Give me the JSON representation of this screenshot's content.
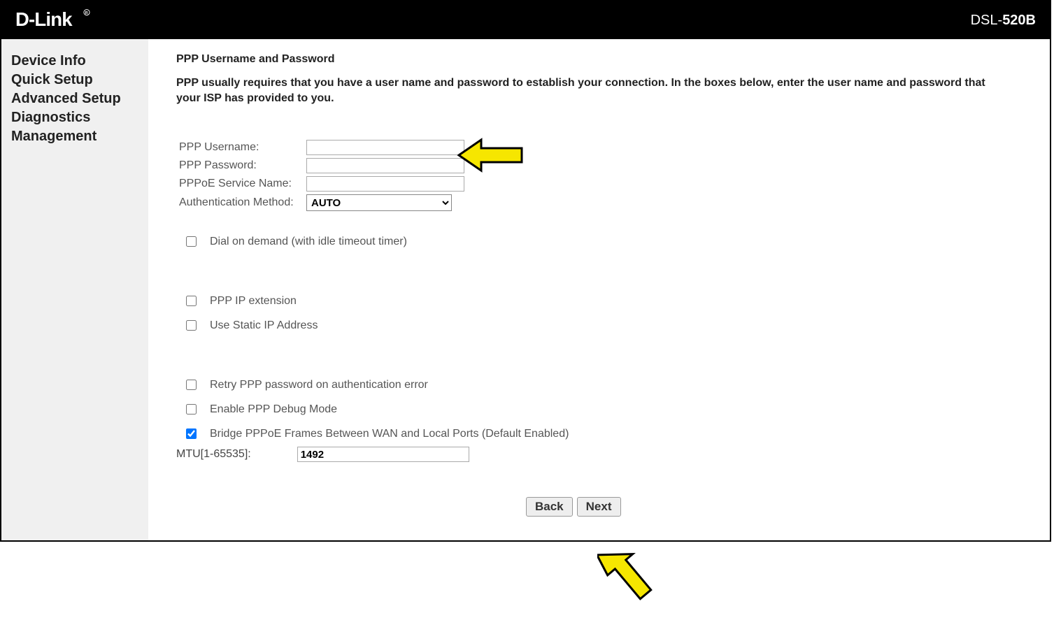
{
  "header": {
    "brand": "D-Link",
    "model_prefix": "DSL-",
    "model_bold": "520B"
  },
  "sidebar": {
    "items": [
      {
        "label": "Device Info"
      },
      {
        "label": "Quick Setup"
      },
      {
        "label": "Advanced Setup"
      },
      {
        "label": "Diagnostics"
      },
      {
        "label": "Management"
      }
    ]
  },
  "main": {
    "heading": "PPP Username and Password",
    "intro": "PPP usually requires that you have a user name and password to establish your connection. In the boxes below, enter the user name and password that your ISP has provided to you.",
    "form": {
      "username_label": "PPP Username:",
      "username_value": "",
      "password_label": "PPP Password:",
      "password_value": "",
      "service_label": "PPPoE Service Name:",
      "service_value": "",
      "auth_label": "Authentication Method:",
      "auth_value": "AUTO"
    },
    "checks": {
      "dial": "Dial on demand (with idle timeout timer)",
      "ipext": "PPP IP extension",
      "staticip": "Use Static IP Address",
      "retry": "Retry PPP password on authentication error",
      "debug": "Enable PPP Debug Mode",
      "bridge": "Bridge PPPoE Frames Between WAN and Local Ports (Default Enabled)"
    },
    "mtu_label": "MTU[1-65535]:",
    "mtu_value": "1492",
    "back": "Back",
    "next": "Next"
  }
}
